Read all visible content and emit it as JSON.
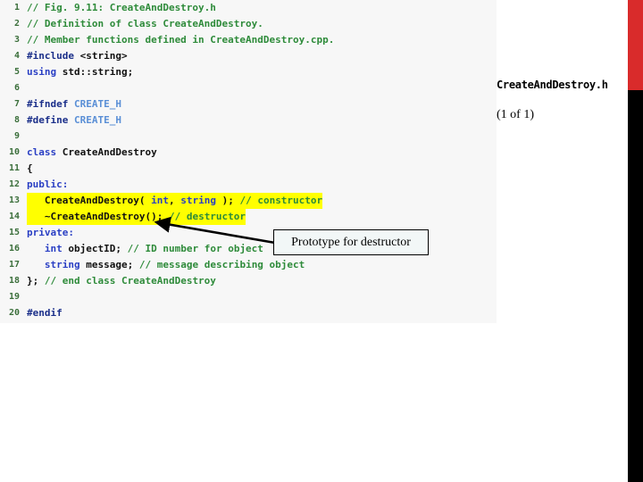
{
  "slide": {
    "file_title": "CreateAndDestroy.h",
    "page_count": "(1 of 1)",
    "callout_text": "Prototype for destructor",
    "colors": {
      "accent_red": "#d92b2b",
      "accent_black": "#000000",
      "highlight_yellow": "#ffff00",
      "panel_background": "#f7f7f7",
      "comment_green": "#2e8b3a",
      "keyword_blue": "#2a3fc4",
      "preprocessor_navy": "#1b2f8a",
      "macro_blue": "#5a8fd6"
    }
  },
  "code": {
    "language": "cpp",
    "lines": [
      {
        "n": "1",
        "highlight": false,
        "tokens": [
          {
            "t": "// Fig. 9.11: CreateAndDestroy.h",
            "c": "c-comment"
          }
        ]
      },
      {
        "n": "2",
        "highlight": false,
        "tokens": [
          {
            "t": "// Definition of class CreateAndDestroy.",
            "c": "c-comment"
          }
        ]
      },
      {
        "n": "3",
        "highlight": false,
        "tokens": [
          {
            "t": "// Member functions defined in CreateAndDestroy.cpp.",
            "c": "c-comment"
          }
        ]
      },
      {
        "n": "4",
        "highlight": false,
        "tokens": [
          {
            "t": "#include ",
            "c": "c-pre"
          },
          {
            "t": "<string>",
            "c": "c-plain"
          }
        ]
      },
      {
        "n": "5",
        "highlight": false,
        "tokens": [
          {
            "t": "using ",
            "c": "c-kw"
          },
          {
            "t": "std::string;",
            "c": "c-plain"
          }
        ]
      },
      {
        "n": "6",
        "highlight": false,
        "tokens": [
          {
            "t": "",
            "c": "c-plain"
          }
        ]
      },
      {
        "n": "7",
        "highlight": false,
        "tokens": [
          {
            "t": "#ifndef ",
            "c": "c-pre"
          },
          {
            "t": "CREATE_H",
            "c": "c-macro"
          }
        ]
      },
      {
        "n": "8",
        "highlight": false,
        "tokens": [
          {
            "t": "#define ",
            "c": "c-pre"
          },
          {
            "t": "CREATE_H",
            "c": "c-macro"
          }
        ]
      },
      {
        "n": "9",
        "highlight": false,
        "tokens": [
          {
            "t": "",
            "c": "c-plain"
          }
        ]
      },
      {
        "n": "10",
        "highlight": false,
        "tokens": [
          {
            "t": "class ",
            "c": "c-kw"
          },
          {
            "t": "CreateAndDestroy",
            "c": "c-plain"
          }
        ]
      },
      {
        "n": "11",
        "highlight": false,
        "tokens": [
          {
            "t": "{",
            "c": "c-op"
          }
        ]
      },
      {
        "n": "12",
        "highlight": false,
        "tokens": [
          {
            "t": "public:",
            "c": "c-kw"
          }
        ]
      },
      {
        "n": "13",
        "highlight": true,
        "tokens": [
          {
            "t": "   CreateAndDestroy( ",
            "c": "c-plain"
          },
          {
            "t": "int",
            "c": "c-kw"
          },
          {
            "t": ", ",
            "c": "c-plain"
          },
          {
            "t": "string",
            "c": "c-kw"
          },
          {
            "t": " ); ",
            "c": "c-plain"
          },
          {
            "t": "// constructor",
            "c": "c-comment"
          }
        ]
      },
      {
        "n": "14",
        "highlight": true,
        "tokens": [
          {
            "t": "   ~CreateAndDestroy(); ",
            "c": "c-plain"
          },
          {
            "t": "// destructor",
            "c": "c-comment"
          }
        ]
      },
      {
        "n": "15",
        "highlight": false,
        "tokens": [
          {
            "t": "private:",
            "c": "c-kw"
          }
        ]
      },
      {
        "n": "16",
        "highlight": false,
        "tokens": [
          {
            "t": "   ",
            "c": "c-plain"
          },
          {
            "t": "int",
            "c": "c-kw"
          },
          {
            "t": " objectID; ",
            "c": "c-plain"
          },
          {
            "t": "// ID number for object",
            "c": "c-comment"
          }
        ]
      },
      {
        "n": "17",
        "highlight": false,
        "tokens": [
          {
            "t": "   ",
            "c": "c-plain"
          },
          {
            "t": "string",
            "c": "c-kw"
          },
          {
            "t": " message; ",
            "c": "c-plain"
          },
          {
            "t": "// message describing object",
            "c": "c-comment"
          }
        ]
      },
      {
        "n": "18",
        "highlight": false,
        "tokens": [
          {
            "t": "}; ",
            "c": "c-plain"
          },
          {
            "t": "// end class CreateAndDestroy",
            "c": "c-comment"
          }
        ]
      },
      {
        "n": "19",
        "highlight": false,
        "tokens": [
          {
            "t": "",
            "c": "c-plain"
          }
        ]
      },
      {
        "n": "20",
        "highlight": false,
        "tokens": [
          {
            "t": "#endif",
            "c": "c-pre"
          }
        ]
      }
    ]
  }
}
